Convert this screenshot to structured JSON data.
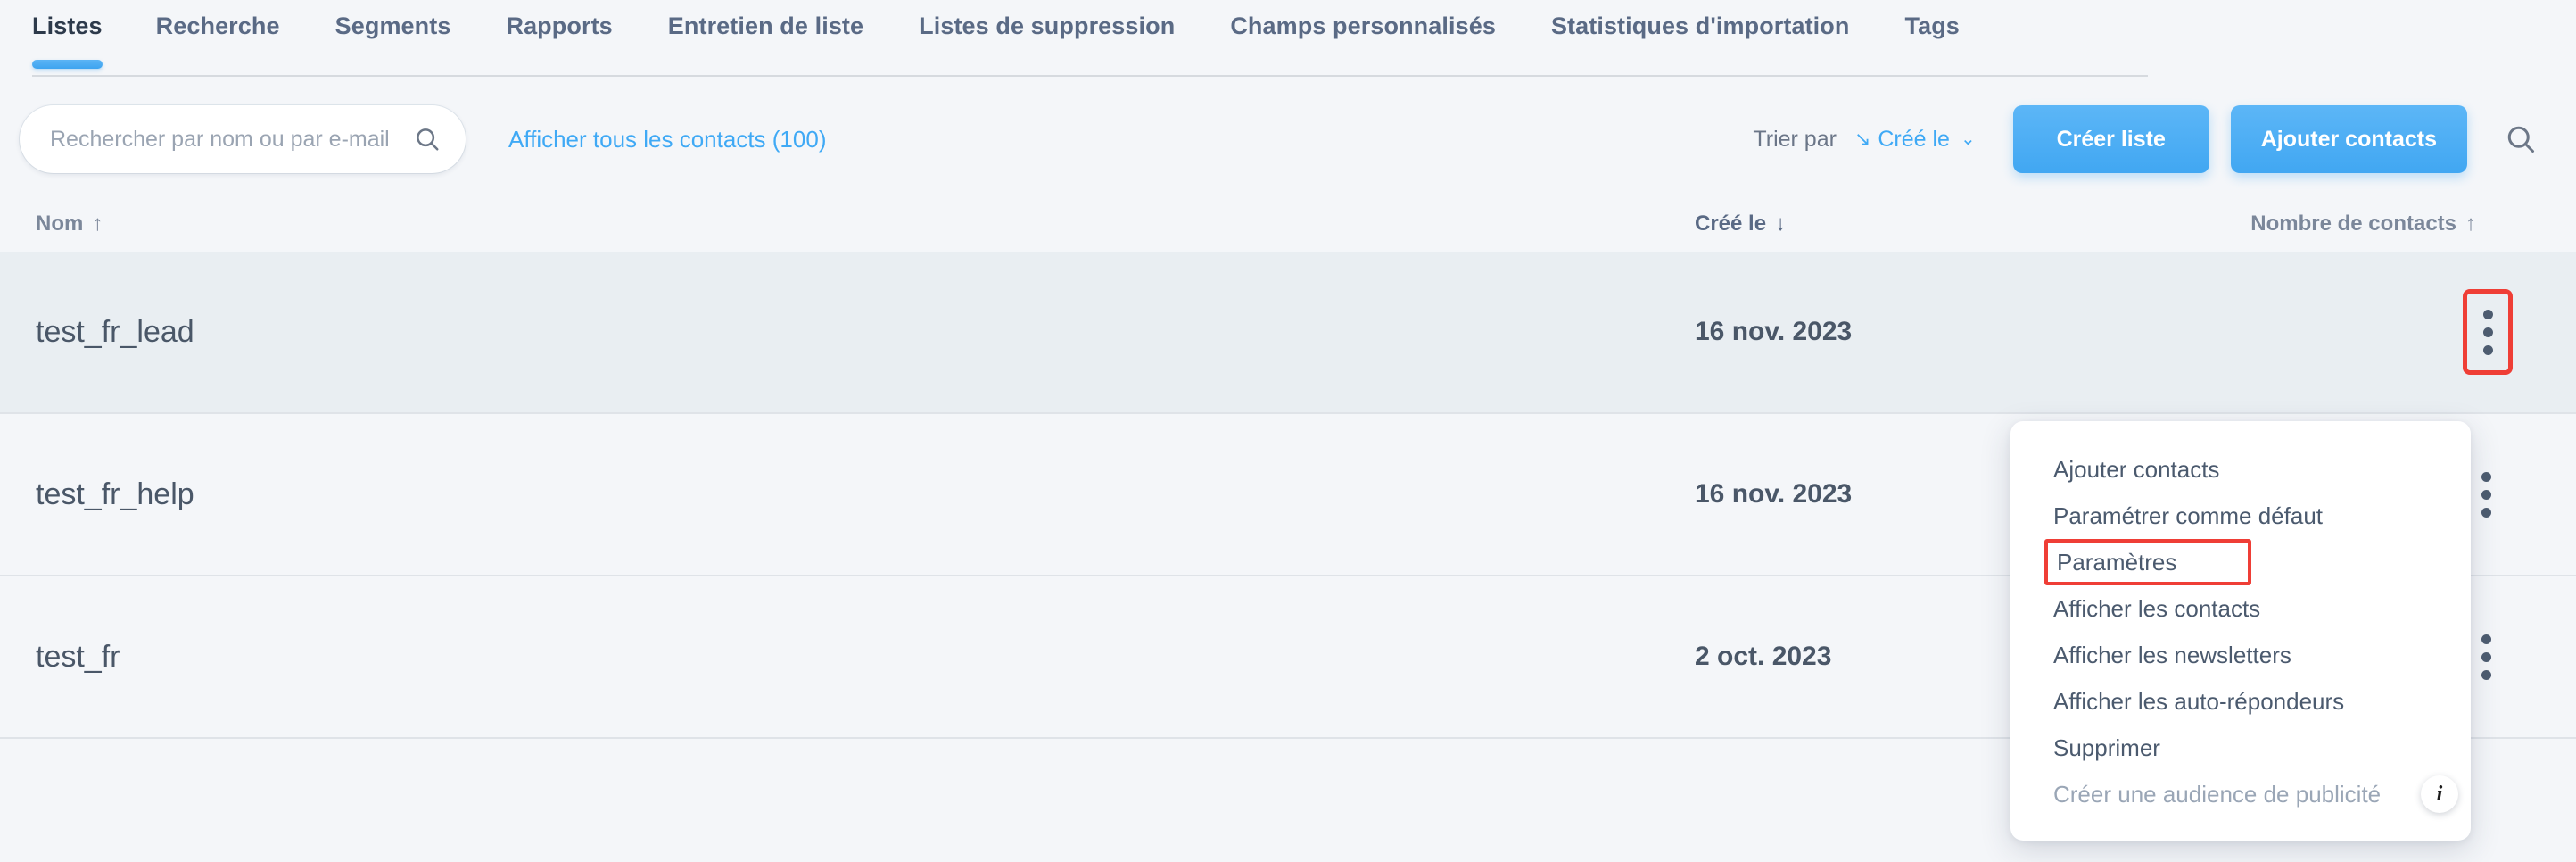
{
  "tabs": [
    {
      "label": "Listes",
      "active": true
    },
    {
      "label": "Recherche",
      "active": false
    },
    {
      "label": "Segments",
      "active": false
    },
    {
      "label": "Rapports",
      "active": false
    },
    {
      "label": "Entretien de liste",
      "active": false
    },
    {
      "label": "Listes de suppression",
      "active": false
    },
    {
      "label": "Champs personnalisés",
      "active": false
    },
    {
      "label": "Statistiques d'importation",
      "active": false
    },
    {
      "label": "Tags",
      "active": false
    }
  ],
  "toolbar": {
    "search_placeholder": "Rechercher par nom ou par e-mail",
    "search_value": "",
    "search_icon": "search-icon",
    "show_all_link": "Afficher tous les contacts (100)",
    "sort_label": "Trier par",
    "sort_arrow": "↘",
    "sort_value": "Créé le",
    "sort_caret": "⌄",
    "create_list_button": "Créer liste",
    "add_contacts_button": "Ajouter contacts",
    "right_search_icon": "search-icon"
  },
  "table": {
    "headers": {
      "name": "Nom",
      "name_sort": "↑",
      "created": "Créé le",
      "created_sort": "↓",
      "count": "Nombre de contacts",
      "count_sort": "↑"
    },
    "rows": [
      {
        "name": "test_fr_lead",
        "created": "16 nov. 2023",
        "count": "",
        "highlight": true,
        "menu_highlighted": true
      },
      {
        "name": "test_fr_help",
        "created": "16 nov. 2023",
        "count": "",
        "highlight": false,
        "menu_highlighted": false
      },
      {
        "name": "test_fr",
        "created": "2 oct. 2023",
        "count": "",
        "highlight": false,
        "menu_highlighted": false
      }
    ]
  },
  "context_menu": {
    "items": [
      {
        "label": "Ajouter contacts",
        "disabled": false,
        "marked": false
      },
      {
        "label": "Paramétrer comme défaut",
        "disabled": false,
        "marked": false
      },
      {
        "label": "Paramètres",
        "disabled": false,
        "marked": true
      },
      {
        "label": "Afficher les contacts",
        "disabled": false,
        "marked": false
      },
      {
        "label": "Afficher les newsletters",
        "disabled": false,
        "marked": false
      },
      {
        "label": "Afficher les auto-répondeurs",
        "disabled": false,
        "marked": false
      },
      {
        "label": "Supprimer",
        "disabled": false,
        "marked": false
      },
      {
        "label": "Créer une audience de publicité",
        "disabled": true,
        "marked": false,
        "badge": "i"
      }
    ]
  },
  "colors": {
    "accent": "#3fa9f5",
    "highlight_red": "#ef3e36",
    "page_bg": "#f4f6f9",
    "text": "#4a5768",
    "muted": "#7b879a"
  }
}
